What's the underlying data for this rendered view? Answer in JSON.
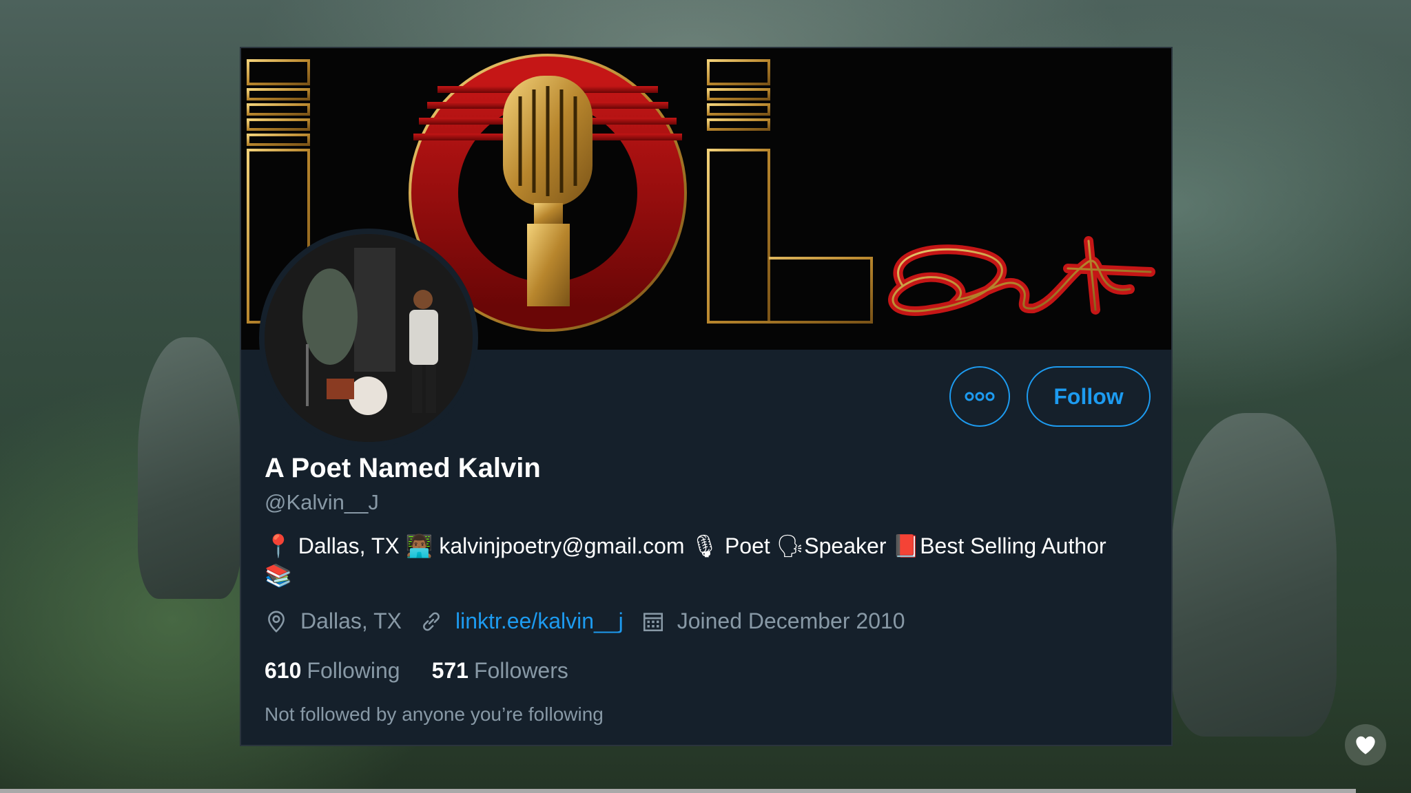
{
  "profile": {
    "name": "A Poet Named Kalvin",
    "handle": "@Kalvin__J",
    "bio": "📍 Dallas, TX 👨🏾‍💻 kalvinjpoetry@gmail.com 🎙 Poet 🗣Speaker 📕Best Selling Author 📚",
    "location": "Dallas, TX",
    "website": "linktr.ee/kalvin__j",
    "joined": "Joined December 2010",
    "following_count": "610",
    "following_label": "Following",
    "followers_count": "571",
    "followers_label": "Followers",
    "mutual_note": "Not followed by anyone you’re following"
  },
  "actions": {
    "more_icon": "more-icon",
    "follow_label": "Follow"
  },
  "banner": {
    "logo_script": "Ent"
  },
  "colors": {
    "accent": "#1d9bf0",
    "card_bg": "#15202b",
    "muted_text": "#8899a6"
  }
}
